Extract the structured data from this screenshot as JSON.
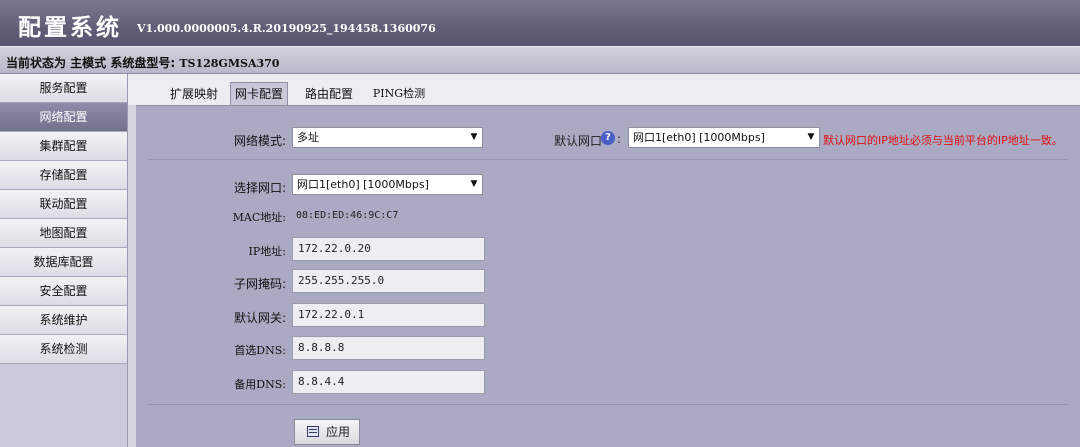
{
  "header": {
    "title": "配置系统",
    "version": "V1.000.0000005.4.R.20190925_194458.1360076"
  },
  "status": {
    "label": "当前状态为 主模式 系统盘型号:",
    "model": "TS128GMSA370"
  },
  "sidebar": {
    "items": [
      {
        "label": "服务配置"
      },
      {
        "label": "网络配置"
      },
      {
        "label": "集群配置"
      },
      {
        "label": "存储配置"
      },
      {
        "label": "联动配置"
      },
      {
        "label": "地图配置"
      },
      {
        "label": "数据库配置"
      },
      {
        "label": "安全配置"
      },
      {
        "label": "系统维护"
      },
      {
        "label": "系统检测"
      }
    ],
    "active_index": 1
  },
  "tabs": [
    {
      "label": "扩展映射"
    },
    {
      "label": "网卡配置"
    },
    {
      "label": "路由配置"
    },
    {
      "label": "PING检测"
    }
  ],
  "form": {
    "network_mode": {
      "label": "网络模式:",
      "value": "多址"
    },
    "default_port": {
      "label": "默认网口",
      "value": "网口1[eth0] [1000Mbps]",
      "note": "默认网口的IP地址必须与当前平台的IP地址一致。"
    },
    "select_port": {
      "label": "选择网口:",
      "value": "网口1[eth0] [1000Mbps]"
    },
    "mac": {
      "label": "MAC地址:",
      "value": "08:ED:ED:46:9C:C7"
    },
    "ip": {
      "label": "IP地址:",
      "value": "172.22.0.20"
    },
    "subnet": {
      "label": "子网掩码:",
      "value": "255.255.255.0"
    },
    "gateway": {
      "label": "默认网关:",
      "value": "172.22.0.1"
    },
    "dns1": {
      "label": "首选DNS:",
      "value": "8.8.8.8"
    },
    "dns2": {
      "label": "备用DNS:",
      "value": "8.8.4.4"
    },
    "help_colon": ":",
    "help_glyph": "?",
    "dropdown_glyph": "▼"
  },
  "actions": {
    "apply": "应用"
  },
  "colors": {
    "header": "#5f5f78",
    "sidebar_active": "#7a7a96",
    "panel": "#aaaac4",
    "note_red": "#e01010"
  }
}
